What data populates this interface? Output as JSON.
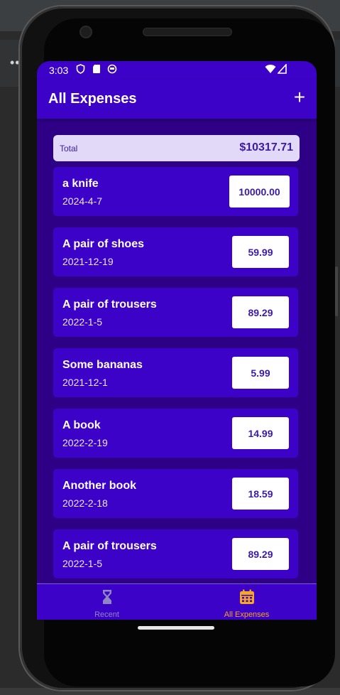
{
  "status": {
    "time": "3:03"
  },
  "appbar": {
    "title": "All Expenses",
    "add_icon": "plus-icon"
  },
  "summary": {
    "label": "Total",
    "value": "$10317.71"
  },
  "expenses": [
    {
      "title": "a knife",
      "date": "2024-4-7",
      "amount": "10000.00"
    },
    {
      "title": "A pair of shoes",
      "date": "2021-12-19",
      "amount": "59.99"
    },
    {
      "title": "A pair of trousers",
      "date": "2022-1-5",
      "amount": "89.29"
    },
    {
      "title": "Some bananas",
      "date": "2021-12-1",
      "amount": "5.99"
    },
    {
      "title": "A book",
      "date": "2022-2-19",
      "amount": "14.99"
    },
    {
      "title": "Another book",
      "date": "2022-2-18",
      "amount": "18.59"
    },
    {
      "title": "A pair of trousers",
      "date": "2022-1-5",
      "amount": "89.29"
    }
  ],
  "bottom_nav": {
    "recent_label": "Recent",
    "all_label": "All Expenses",
    "recent_icon": "hourglass-icon",
    "all_icon": "calendar-icon"
  },
  "colors": {
    "primary": "#3d02c7",
    "background": "#2e0086",
    "summary_card": "#e2d8f7",
    "accent": "#f5a623"
  }
}
